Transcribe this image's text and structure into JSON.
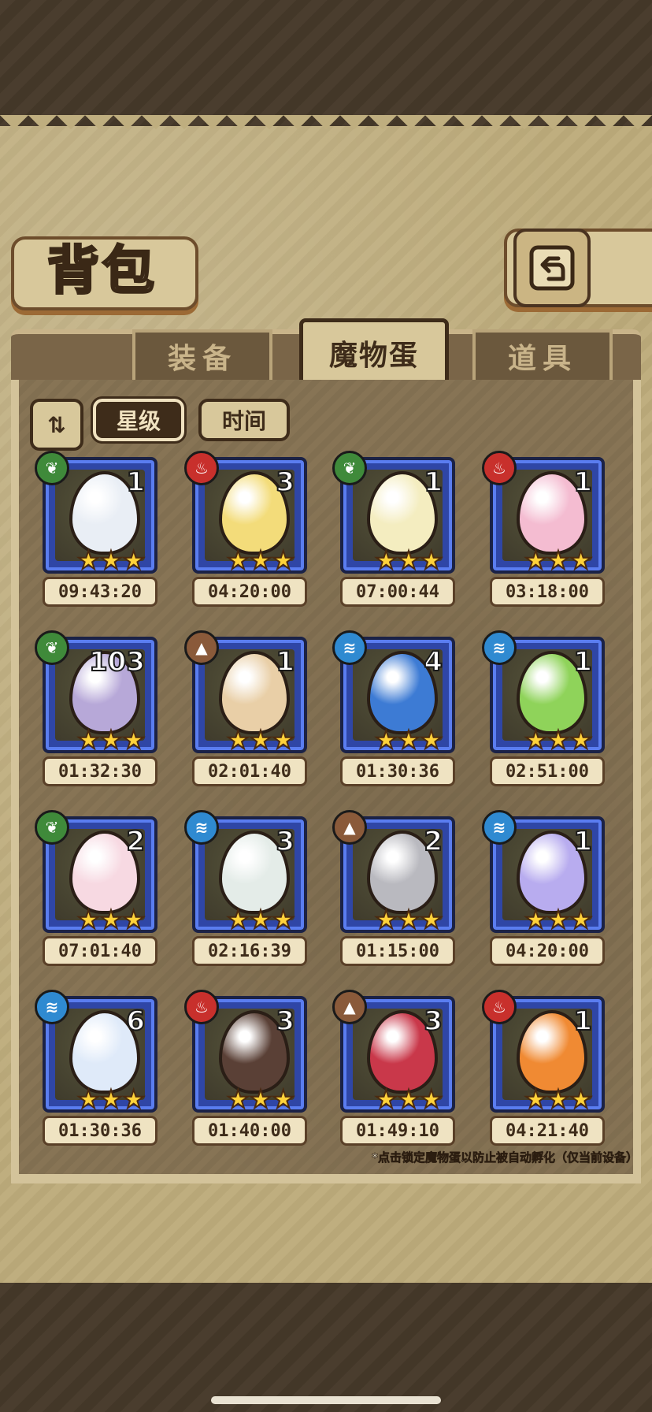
{
  "header": {
    "title": "背包"
  },
  "tabs": [
    {
      "label": "装备",
      "active": false
    },
    {
      "label": "魔物蛋",
      "active": true
    },
    {
      "label": "道具",
      "active": false
    }
  ],
  "filters": {
    "sort_toggle": "⇅",
    "sort_star": "星级",
    "sort_time": "时间"
  },
  "eggs": [
    {
      "element": "grass",
      "count": "1",
      "stars": "★★★",
      "timer": "09:43:20",
      "color": "#e9eef5"
    },
    {
      "element": "fire",
      "count": "3",
      "stars": "★★★",
      "timer": "04:20:00",
      "color": "#f3dc7a"
    },
    {
      "element": "grass",
      "count": "1",
      "stars": "★★★",
      "timer": "07:00:44",
      "color": "#f4edc0"
    },
    {
      "element": "fire",
      "count": "1",
      "stars": "★★★",
      "timer": "03:18:00",
      "color": "#f4bcd1"
    },
    {
      "element": "grass",
      "count": "103",
      "stars": "★★★",
      "timer": "01:32:30",
      "color": "#b7a8d8"
    },
    {
      "element": "earth",
      "count": "1",
      "stars": "★★★",
      "timer": "02:01:40",
      "color": "#e9cfa7"
    },
    {
      "element": "water",
      "count": "4",
      "stars": "★★★",
      "timer": "01:30:36",
      "color": "#3d7bd4"
    },
    {
      "element": "water",
      "count": "1",
      "stars": "★★★",
      "timer": "02:51:00",
      "color": "#8fd35a"
    },
    {
      "element": "grass",
      "count": "2",
      "stars": "★★★",
      "timer": "07:01:40",
      "color": "#f7d9e2"
    },
    {
      "element": "water",
      "count": "3",
      "stars": "★★★",
      "timer": "02:16:39",
      "color": "#e4ece8"
    },
    {
      "element": "earth",
      "count": "2",
      "stars": "★★★",
      "timer": "01:15:00",
      "color": "#b9b9bf"
    },
    {
      "element": "water",
      "count": "1",
      "stars": "★★★",
      "timer": "04:20:00",
      "color": "#b8acef"
    },
    {
      "element": "water",
      "count": "6",
      "stars": "★★★",
      "timer": "01:30:36",
      "color": "#dfeaf9"
    },
    {
      "element": "fire",
      "count": "3",
      "stars": "★★★",
      "timer": "01:40:00",
      "color": "#5a4036"
    },
    {
      "element": "earth",
      "count": "3",
      "stars": "★★★",
      "timer": "01:49:10",
      "color": "#c9384a"
    },
    {
      "element": "fire",
      "count": "1",
      "stars": "★★★",
      "timer": "04:21:40",
      "color": "#f08a33"
    }
  ],
  "element_icons": {
    "grass": "❦",
    "fire": "♨",
    "water": "≋",
    "earth": "▲"
  },
  "hint": "*点击锁定魔物蛋以防止被自动孵化（仅当前设备）"
}
